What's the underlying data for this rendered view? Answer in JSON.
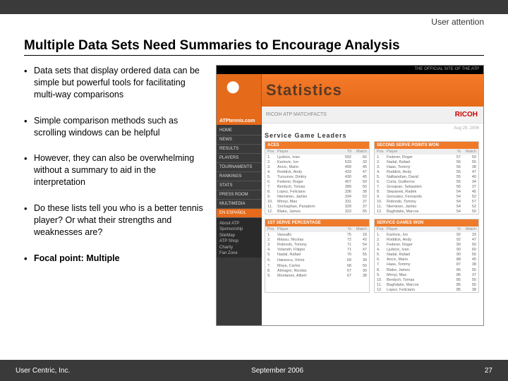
{
  "header": {
    "label": "User attention"
  },
  "title": "Multiple Data Sets Need Summaries to Encourage Analysis",
  "bullets": [
    {
      "text": "Data sets that display ordered data can be simple but powerful tools for facilitating multi-way comparisons",
      "bold": false
    },
    {
      "text": "Simple comparison methods such as scrolling windows can be helpful",
      "bold": false
    },
    {
      "text": "However, they can also be overwhelming without a summary to aid in the interpretation",
      "bold": false
    },
    {
      "text": "Do these lists tell you who is a better tennis player? Or what their strengths and weaknesses are?",
      "bold": false
    },
    {
      "text": "Focal point: Multiple",
      "bold": true
    }
  ],
  "figure": {
    "topbar": "THE OFFICIAL SITE OF THE ATP",
    "logo_text": "ATPtennis.com",
    "banner_text": "Statistics",
    "subbanner_left": "RICOH ATP MATCHFACTS",
    "subbanner_brand": "RICOH",
    "date": "Aug 28, 2006",
    "section_title": "Service Game Leaders",
    "nav": [
      "HOME",
      "NEWS",
      "RESULTS",
      "PLAYERS",
      "TOURNAMENTS",
      "RANKINGS",
      "STATS",
      "PRESS ROOM",
      "MULTIMEDIA"
    ],
    "nav_esp": "EN ESPAÑOL",
    "nav_about": "About ATP\nSponsorship\nSiteMap\nATP Shop\nCharity\nFan Zone",
    "cards": [
      {
        "title": "ACES",
        "cols": [
          "Pos",
          "Player",
          "Ttl",
          "Match"
        ],
        "rows": [
          [
            "1.",
            "Ljubicic, Ivan",
            "592",
            "60"
          ],
          [
            "2.",
            "Karlovic, Ivo",
            "533",
            "33"
          ],
          [
            "3.",
            "Ancic, Mario",
            "499",
            "45"
          ],
          [
            "4.",
            "Roddick, Andy",
            "433",
            "47"
          ],
          [
            "5.",
            "Tursunov, Dmitry",
            "430",
            "45"
          ],
          [
            "6.",
            "Federer, Roger",
            "407",
            "50"
          ],
          [
            "7.",
            "Berdych, Tomas",
            "389",
            "50"
          ],
          [
            "8.",
            "Lopez, Feliciano",
            "336",
            "38"
          ],
          [
            "9.",
            "Nieminen, Jarkko",
            "334",
            "52"
          ],
          [
            "10.",
            "Mirnyi, Max",
            "331",
            "37"
          ],
          [
            "11.",
            "Srichaphan, Paradorn",
            "329",
            "37"
          ],
          [
            "12.",
            "Blake, James",
            "323",
            "55"
          ]
        ]
      },
      {
        "title": "SECOND SERVE POINTS WON",
        "cols": [
          "Pos",
          "Player",
          "%",
          "Match"
        ],
        "rows": [
          [
            "1.",
            "Federer, Roger",
            "57",
            "50"
          ],
          [
            "2.",
            "Nadal, Rafael",
            "56",
            "55"
          ],
          [
            "3.",
            "Haas, Tommy",
            "56",
            "38"
          ],
          [
            "4.",
            "Roddick, Andy",
            "55",
            "47"
          ],
          [
            "5.",
            "Nalbandian, David",
            "55",
            "40"
          ],
          [
            "6.",
            "Coria, Guillermo",
            "55",
            "34"
          ],
          [
            "7.",
            "Grosjean, Sebastien",
            "55",
            "37"
          ],
          [
            "8.",
            "Stepanek, Radek",
            "54",
            "45"
          ],
          [
            "9.",
            "Gonzalez, Fernando",
            "54",
            "52"
          ],
          [
            "10.",
            "Robredo, Tommy",
            "54",
            "57"
          ],
          [
            "11.",
            "Nieminen, Jarkko",
            "54",
            "52"
          ],
          [
            "12.",
            "Baghdatis, Marcos",
            "54",
            "50"
          ]
        ]
      },
      {
        "title": "1ST SERVE PERCENTAGE",
        "cols": [
          "Pos",
          "Player",
          "%",
          "Match"
        ],
        "rows": [
          [
            "1.",
            "Vassallo",
            "75",
            "18"
          ],
          [
            "2.",
            "Massu, Nicolas",
            "72",
            "42"
          ],
          [
            "3.",
            "Robredo, Tommy",
            "71",
            "54"
          ],
          [
            "4.",
            "Volandri, Filippo",
            "71",
            "47"
          ],
          [
            "5.",
            "Nadal, Rafael",
            "70",
            "55"
          ],
          [
            "",
            "",
            "",
            ""
          ],
          [
            "6.",
            "Hanescu, Victor",
            "69",
            "39"
          ],
          [
            "",
            "",
            "",
            ""
          ],
          [
            "7.",
            "Moya, Carlos",
            "68",
            "50"
          ],
          [
            "8.",
            "Almagro, Nicolas",
            "67",
            "30"
          ],
          [
            "9.",
            "Montanes, Albert",
            "67",
            "38"
          ]
        ]
      },
      {
        "title": "SERVICE GAMES WON",
        "cols": [
          "Pos",
          "Player",
          "%",
          "Match"
        ],
        "rows": [
          [
            "1.",
            "Karlovic, Ivo",
            "92",
            "33"
          ],
          [
            "2.",
            "Roddick, Andy",
            "92",
            "47"
          ],
          [
            "3.",
            "Federer, Roger",
            "90",
            "50"
          ],
          [
            "4.",
            "Ljubicic, Ivan",
            "90",
            "60"
          ],
          [
            "5.",
            "Nadal, Rafael",
            "90",
            "55"
          ],
          [
            "6.",
            "Ancic, Mario",
            "88",
            "45"
          ],
          [
            "7.",
            "Haas, Tommy",
            "87",
            "38"
          ],
          [
            "",
            "",
            "",
            ""
          ],
          [
            "8.",
            "Blake, James",
            "86",
            "55"
          ],
          [
            "9.",
            "Mirnyi, Max",
            "86",
            "37"
          ],
          [
            "10.",
            "Berdych, Tomas",
            "85",
            "50"
          ],
          [
            "11.",
            "Baghdatis, Marcos",
            "85",
            "50"
          ],
          [
            "12.",
            "Lopez, Feliciano",
            "85",
            "38"
          ]
        ]
      }
    ]
  },
  "footer": {
    "left": "User Centric, Inc.",
    "center": "September 2006",
    "right": "27"
  }
}
